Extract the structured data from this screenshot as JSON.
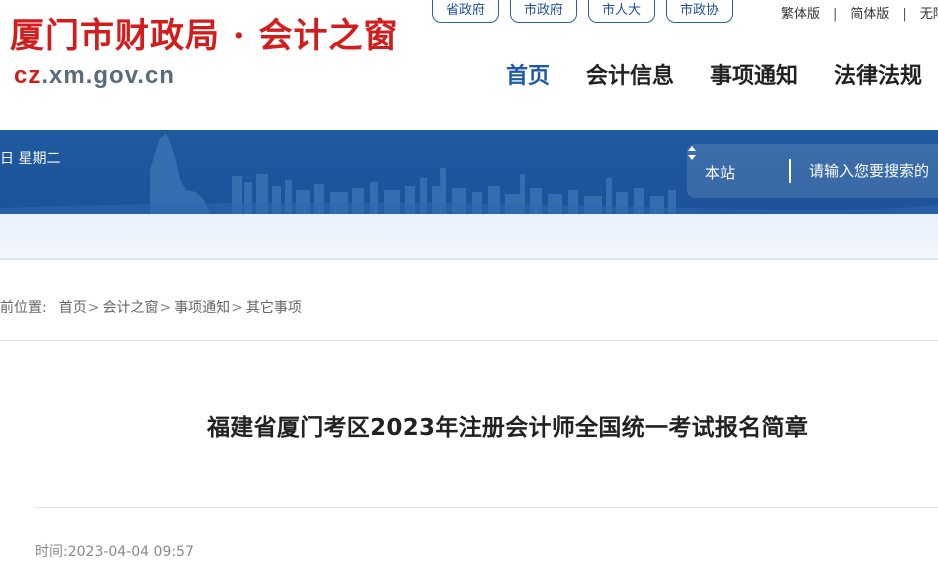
{
  "header": {
    "site_title": "厦门市财政局 · 会计之窗",
    "url_prefix": "cz",
    "url_rest": ".xm.gov.cn",
    "quick_links": [
      "省政府",
      "市政府",
      "市人大",
      "市政协"
    ],
    "lang_links": [
      "繁体版",
      "简体版",
      "无障"
    ],
    "nav": [
      "首页",
      "会计信息",
      "事项通知",
      "法律法规"
    ]
  },
  "banner": {
    "date_text": "日 星期二",
    "search_scope": "本站",
    "search_placeholder": "请输入您要搜索的"
  },
  "breadcrumb": {
    "label": "前位置:",
    "items": [
      "首页",
      "会计之窗",
      "事项通知",
      "其它事项"
    ]
  },
  "article": {
    "title": "福建省厦门考区2023年注册会计师全国统一考试报名简章",
    "time_label": "时间:",
    "time_value": "2023-04-04 09:57"
  },
  "colors": {
    "brand_red": "#d31d1d",
    "nav_active": "#1f5aa6",
    "banner_blue": "#1d559c"
  }
}
